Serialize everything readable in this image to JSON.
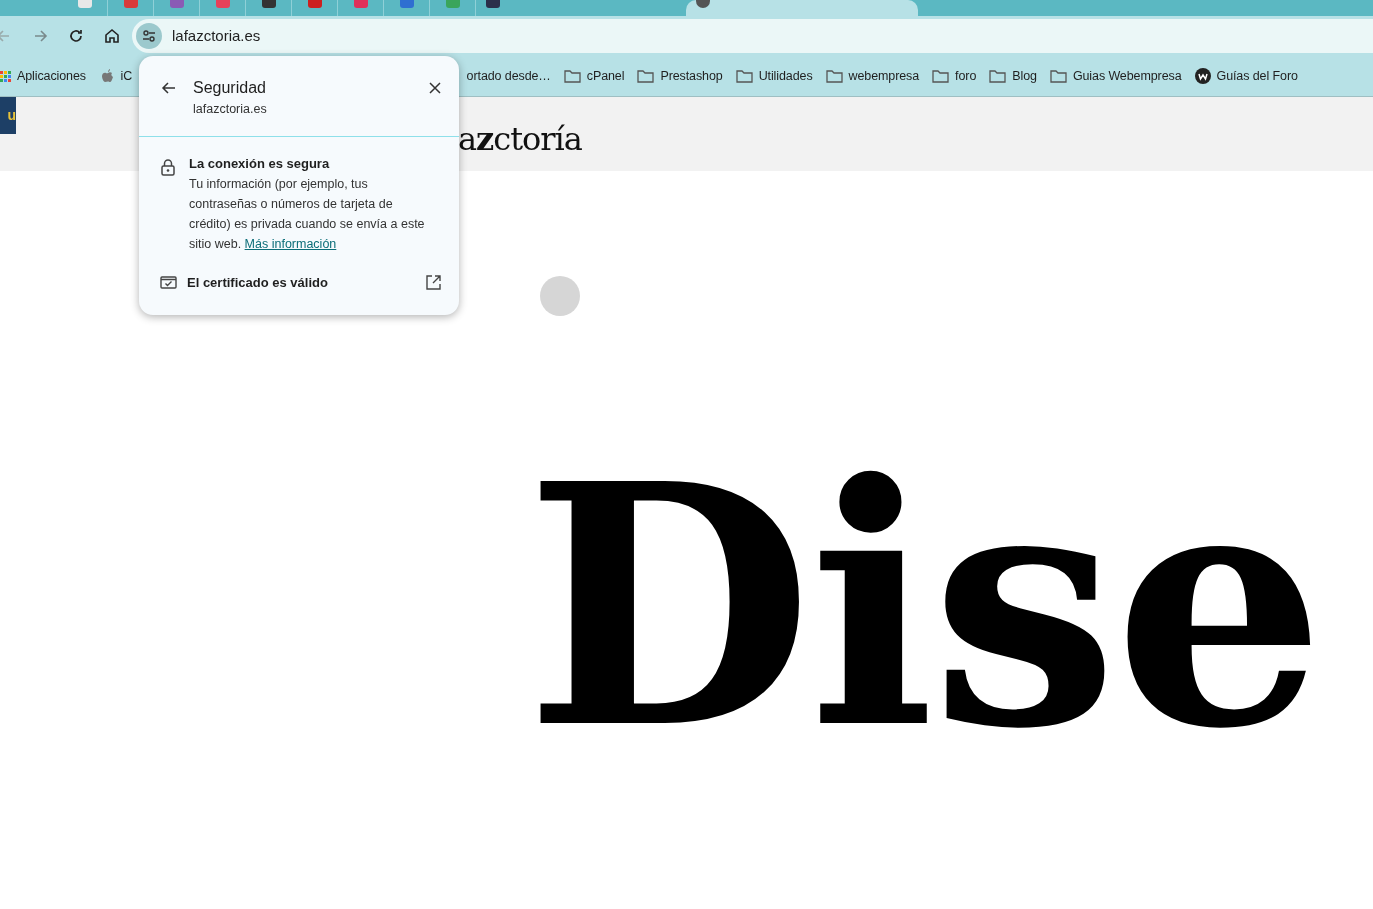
{
  "tabs": [
    {
      "selected": false,
      "color": "#e8e8e8"
    },
    {
      "selected": false,
      "color": "#d93a3a"
    },
    {
      "selected": false,
      "color": "#8a5bb5"
    },
    {
      "selected": false,
      "color": "#e8415a"
    },
    {
      "selected": false,
      "color": "#333333"
    },
    {
      "selected": false,
      "color": "#cc1f1f"
    },
    {
      "selected": false,
      "color": "#e0305a"
    },
    {
      "selected": false,
      "color": "#2f6fd1"
    },
    {
      "selected": false,
      "color": "#3aa55c"
    },
    {
      "selected": false,
      "color": "#2b2f4a"
    },
    {
      "selected": true,
      "color": "#555555"
    }
  ],
  "address_bar": {
    "url": "lafazctoria.es"
  },
  "bookmarks": [
    {
      "kind": "apps",
      "label": "Aplicaciones"
    },
    {
      "kind": "apple",
      "label": "iC"
    },
    {
      "kind": "plain",
      "label": "ortado desde…"
    },
    {
      "kind": "folder",
      "label": "cPanel"
    },
    {
      "kind": "folder",
      "label": "Prestashop"
    },
    {
      "kind": "folder",
      "label": "Utilidades"
    },
    {
      "kind": "folder",
      "label": "webempresa"
    },
    {
      "kind": "folder",
      "label": "foro"
    },
    {
      "kind": "folder",
      "label": "Blog"
    },
    {
      "kind": "folder",
      "label": "Guias Webempresa"
    },
    {
      "kind": "site",
      "label": "Guías del Foro"
    }
  ],
  "page": {
    "corner_logo": "u",
    "logo": "a**z**ctoría",
    "headline": "Dise"
  },
  "security_popup": {
    "title": "Seguridad",
    "site": "lafazctoria.es",
    "connection_title": "La conexión es segura",
    "connection_text": "Tu información (por ejemplo, tus contraseñas o números de tarjeta de crédito) es privada cuando se envía a este sitio web.",
    "link": "Más información",
    "certificate": "El certificado es válido"
  }
}
